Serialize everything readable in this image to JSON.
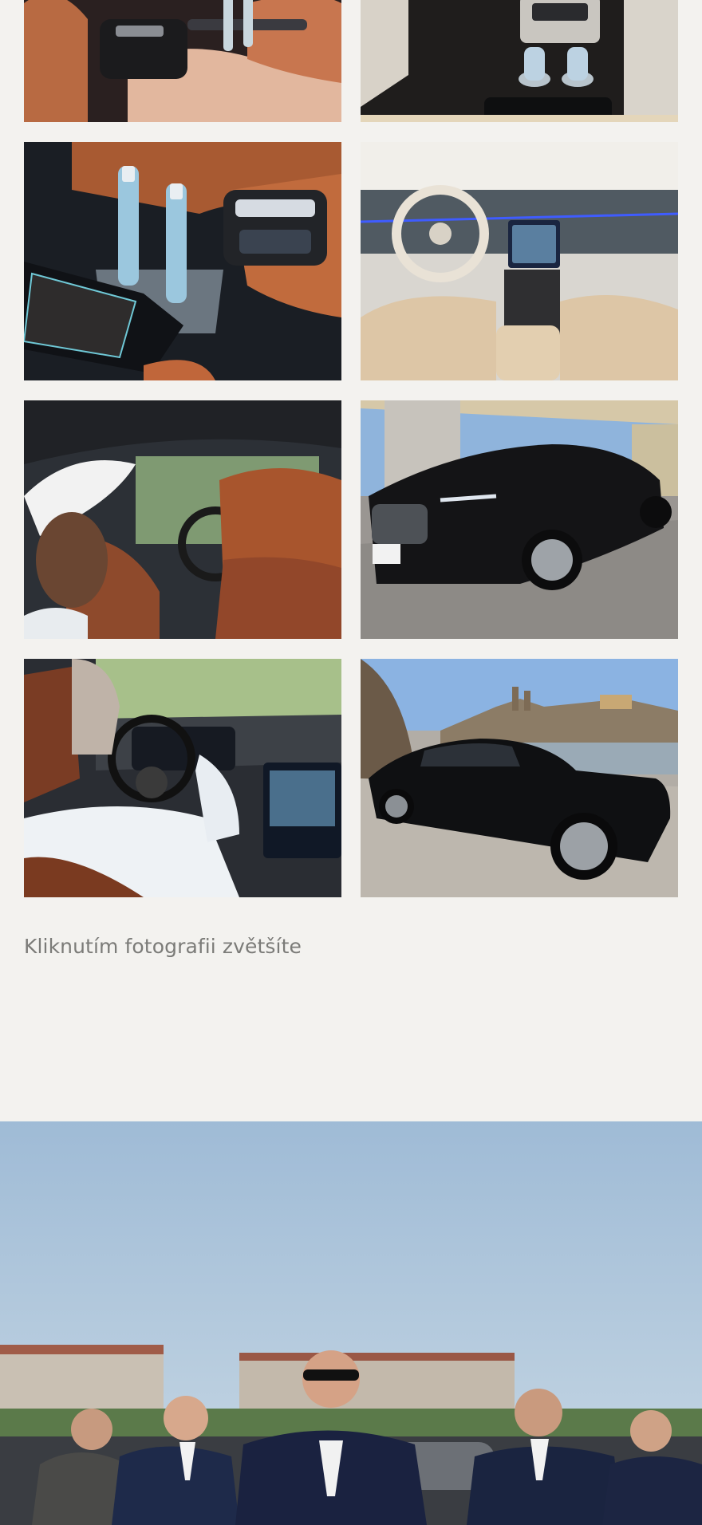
{
  "gallery": {
    "caption": "Kliknutím fotografii zvětšíte",
    "photos": [
      {
        "name": "photo-rear-armrest-controls",
        "subject": "interior"
      },
      {
        "name": "photo-console-water-bottles",
        "subject": "interior"
      },
      {
        "name": "photo-bottles-closeup",
        "subject": "interior"
      },
      {
        "name": "photo-dashboard-front-seats",
        "subject": "interior"
      },
      {
        "name": "photo-passenger-rear-view",
        "subject": "interior"
      },
      {
        "name": "photo-black-sedan-front",
        "subject": "exterior"
      },
      {
        "name": "photo-driver-at-wheel",
        "subject": "interior"
      },
      {
        "name": "photo-black-sedan-side-castle",
        "subject": "exterior"
      }
    ]
  },
  "colors": {
    "background": "#f3f2ef",
    "caption_text": "#7b7b78",
    "leather_tan": "#c8764f",
    "car_black": "#141416",
    "sky_blue": "#a9c4dd"
  },
  "team_banner": {
    "subject": "chauffeur-team-photo"
  }
}
